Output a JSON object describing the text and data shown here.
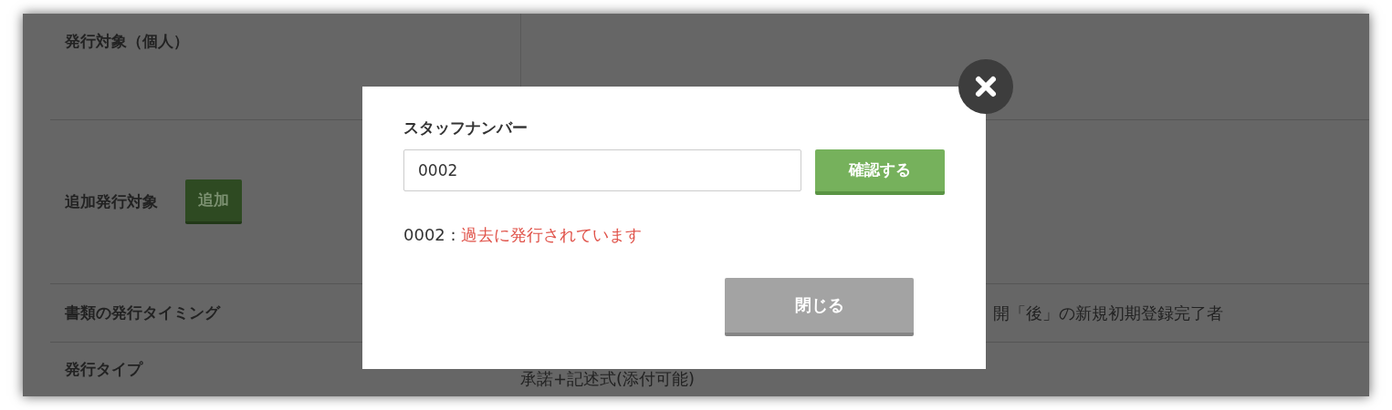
{
  "background_table": {
    "rows": [
      {
        "label": "発行対象（個人）"
      },
      {
        "label": "追加発行対象",
        "button": "追加"
      },
      {
        "label": "書類の発行タイミング",
        "value": "開「後」の新規初期登録完了者"
      },
      {
        "label": "発行タイプ",
        "value": "承諾+記述式(添付可能)"
      }
    ]
  },
  "dialog": {
    "field_label": "スタッフナンバー",
    "field_value": "0002",
    "confirm_button": "確認する",
    "message_prefix": "0002 :",
    "message": "過去に発行されています",
    "close_button": "閉じる"
  }
}
